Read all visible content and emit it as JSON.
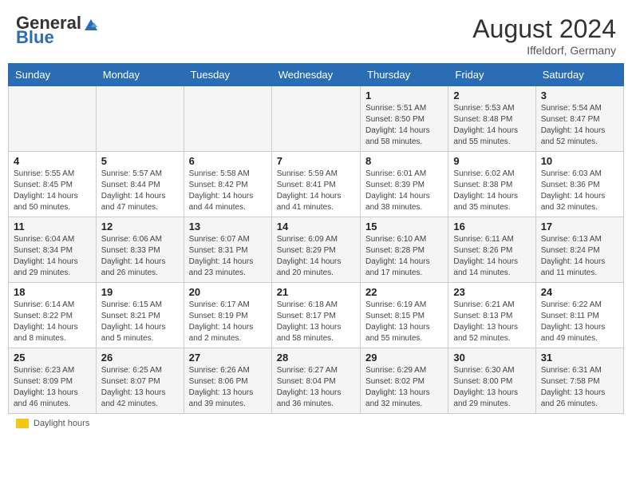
{
  "logo": {
    "general": "General",
    "blue": "Blue"
  },
  "title": {
    "month_year": "August 2024",
    "location": "Iffeldorf, Germany"
  },
  "days_of_week": [
    "Sunday",
    "Monday",
    "Tuesday",
    "Wednesday",
    "Thursday",
    "Friday",
    "Saturday"
  ],
  "legend": {
    "text": "Daylight hours"
  },
  "weeks": [
    [
      {
        "day": "",
        "info": ""
      },
      {
        "day": "",
        "info": ""
      },
      {
        "day": "",
        "info": ""
      },
      {
        "day": "",
        "info": ""
      },
      {
        "day": "1",
        "info": "Sunrise: 5:51 AM\nSunset: 8:50 PM\nDaylight: 14 hours\nand 58 minutes."
      },
      {
        "day": "2",
        "info": "Sunrise: 5:53 AM\nSunset: 8:48 PM\nDaylight: 14 hours\nand 55 minutes."
      },
      {
        "day": "3",
        "info": "Sunrise: 5:54 AM\nSunset: 8:47 PM\nDaylight: 14 hours\nand 52 minutes."
      }
    ],
    [
      {
        "day": "4",
        "info": "Sunrise: 5:55 AM\nSunset: 8:45 PM\nDaylight: 14 hours\nand 50 minutes."
      },
      {
        "day": "5",
        "info": "Sunrise: 5:57 AM\nSunset: 8:44 PM\nDaylight: 14 hours\nand 47 minutes."
      },
      {
        "day": "6",
        "info": "Sunrise: 5:58 AM\nSunset: 8:42 PM\nDaylight: 14 hours\nand 44 minutes."
      },
      {
        "day": "7",
        "info": "Sunrise: 5:59 AM\nSunset: 8:41 PM\nDaylight: 14 hours\nand 41 minutes."
      },
      {
        "day": "8",
        "info": "Sunrise: 6:01 AM\nSunset: 8:39 PM\nDaylight: 14 hours\nand 38 minutes."
      },
      {
        "day": "9",
        "info": "Sunrise: 6:02 AM\nSunset: 8:38 PM\nDaylight: 14 hours\nand 35 minutes."
      },
      {
        "day": "10",
        "info": "Sunrise: 6:03 AM\nSunset: 8:36 PM\nDaylight: 14 hours\nand 32 minutes."
      }
    ],
    [
      {
        "day": "11",
        "info": "Sunrise: 6:04 AM\nSunset: 8:34 PM\nDaylight: 14 hours\nand 29 minutes."
      },
      {
        "day": "12",
        "info": "Sunrise: 6:06 AM\nSunset: 8:33 PM\nDaylight: 14 hours\nand 26 minutes."
      },
      {
        "day": "13",
        "info": "Sunrise: 6:07 AM\nSunset: 8:31 PM\nDaylight: 14 hours\nand 23 minutes."
      },
      {
        "day": "14",
        "info": "Sunrise: 6:09 AM\nSunset: 8:29 PM\nDaylight: 14 hours\nand 20 minutes."
      },
      {
        "day": "15",
        "info": "Sunrise: 6:10 AM\nSunset: 8:28 PM\nDaylight: 14 hours\nand 17 minutes."
      },
      {
        "day": "16",
        "info": "Sunrise: 6:11 AM\nSunset: 8:26 PM\nDaylight: 14 hours\nand 14 minutes."
      },
      {
        "day": "17",
        "info": "Sunrise: 6:13 AM\nSunset: 8:24 PM\nDaylight: 14 hours\nand 11 minutes."
      }
    ],
    [
      {
        "day": "18",
        "info": "Sunrise: 6:14 AM\nSunset: 8:22 PM\nDaylight: 14 hours\nand 8 minutes."
      },
      {
        "day": "19",
        "info": "Sunrise: 6:15 AM\nSunset: 8:21 PM\nDaylight: 14 hours\nand 5 minutes."
      },
      {
        "day": "20",
        "info": "Sunrise: 6:17 AM\nSunset: 8:19 PM\nDaylight: 14 hours\nand 2 minutes."
      },
      {
        "day": "21",
        "info": "Sunrise: 6:18 AM\nSunset: 8:17 PM\nDaylight: 13 hours\nand 58 minutes."
      },
      {
        "day": "22",
        "info": "Sunrise: 6:19 AM\nSunset: 8:15 PM\nDaylight: 13 hours\nand 55 minutes."
      },
      {
        "day": "23",
        "info": "Sunrise: 6:21 AM\nSunset: 8:13 PM\nDaylight: 13 hours\nand 52 minutes."
      },
      {
        "day": "24",
        "info": "Sunrise: 6:22 AM\nSunset: 8:11 PM\nDaylight: 13 hours\nand 49 minutes."
      }
    ],
    [
      {
        "day": "25",
        "info": "Sunrise: 6:23 AM\nSunset: 8:09 PM\nDaylight: 13 hours\nand 46 minutes."
      },
      {
        "day": "26",
        "info": "Sunrise: 6:25 AM\nSunset: 8:07 PM\nDaylight: 13 hours\nand 42 minutes."
      },
      {
        "day": "27",
        "info": "Sunrise: 6:26 AM\nSunset: 8:06 PM\nDaylight: 13 hours\nand 39 minutes."
      },
      {
        "day": "28",
        "info": "Sunrise: 6:27 AM\nSunset: 8:04 PM\nDaylight: 13 hours\nand 36 minutes."
      },
      {
        "day": "29",
        "info": "Sunrise: 6:29 AM\nSunset: 8:02 PM\nDaylight: 13 hours\nand 32 minutes."
      },
      {
        "day": "30",
        "info": "Sunrise: 6:30 AM\nSunset: 8:00 PM\nDaylight: 13 hours\nand 29 minutes."
      },
      {
        "day": "31",
        "info": "Sunrise: 6:31 AM\nSunset: 7:58 PM\nDaylight: 13 hours\nand 26 minutes."
      }
    ]
  ]
}
